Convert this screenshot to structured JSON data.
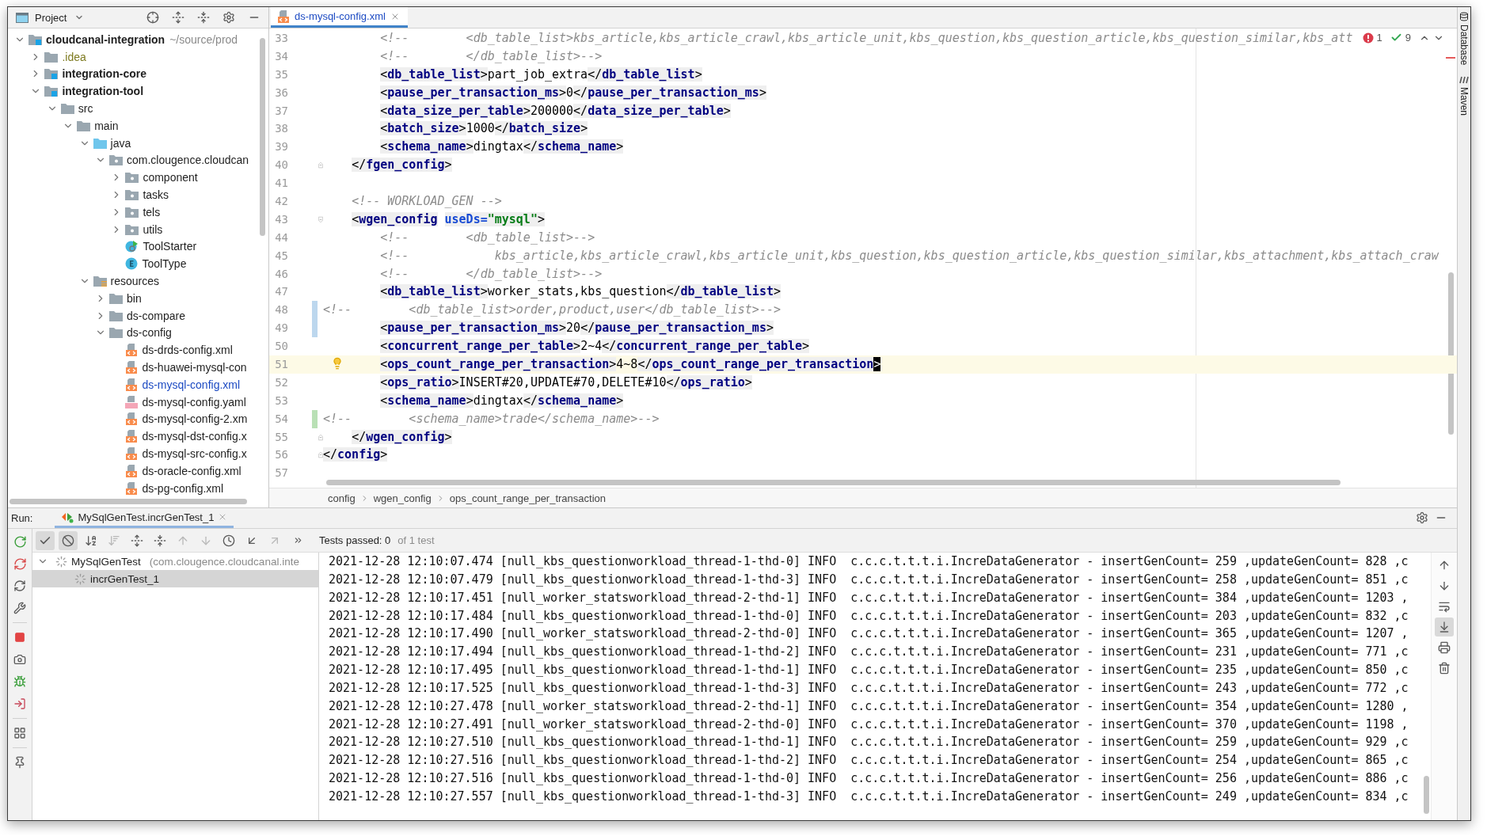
{
  "project": {
    "title": "Project",
    "tree": [
      {
        "label": "cloudcanal-integration",
        "hint": "~/source/prod",
        "kind": "module",
        "expanded": true,
        "children": [
          {
            "label": ".idea",
            "kind": "folder",
            "expanded": false,
            "ignored": true
          },
          {
            "label": "integration-core",
            "kind": "module",
            "expanded": false,
            "ignored": false
          },
          {
            "label": "integration-tool",
            "kind": "module",
            "expanded": true,
            "ignored": false,
            "children": [
              {
                "label": "src",
                "kind": "folder",
                "expanded": true,
                "children": [
                  {
                    "label": "main",
                    "kind": "folder",
                    "expanded": true,
                    "children": [
                      {
                        "label": "java",
                        "kind": "source",
                        "expanded": true,
                        "children": [
                          {
                            "label": "com.clougence.cloudcan",
                            "kind": "package",
                            "expanded": true,
                            "children": [
                              {
                                "label": "component",
                                "kind": "package",
                                "expanded": false
                              },
                              {
                                "label": "tasks",
                                "kind": "package",
                                "expanded": false
                              },
                              {
                                "label": "tels",
                                "kind": "package",
                                "expanded": false
                              },
                              {
                                "label": "utils",
                                "kind": "package",
                                "expanded": false
                              },
                              {
                                "label": "ToolStarter",
                                "kind": "class-main"
                              },
                              {
                                "label": "ToolType",
                                "kind": "enum"
                              }
                            ]
                          }
                        ]
                      },
                      {
                        "label": "resources",
                        "kind": "resources",
                        "expanded": true,
                        "children": [
                          {
                            "label": "bin",
                            "kind": "folder",
                            "expanded": false
                          },
                          {
                            "label": "ds-compare",
                            "kind": "folder",
                            "expanded": false
                          },
                          {
                            "label": "ds-config",
                            "kind": "folder",
                            "expanded": true,
                            "children": [
                              {
                                "label": "ds-drds-config.xml",
                                "kind": "xml",
                                "modified": false
                              },
                              {
                                "label": "ds-huawei-mysql-con",
                                "kind": "xml",
                                "modified": false
                              },
                              {
                                "label": "ds-mysql-config.xml",
                                "kind": "xml",
                                "modified": true
                              },
                              {
                                "label": "ds-mysql-config.yaml",
                                "kind": "yaml",
                                "modified": false
                              },
                              {
                                "label": "ds-mysql-config-2.xm",
                                "kind": "xml",
                                "modified": false
                              },
                              {
                                "label": "ds-mysql-dst-config.x",
                                "kind": "xml",
                                "modified": false
                              },
                              {
                                "label": "ds-mysql-src-config.x",
                                "kind": "xml",
                                "modified": false
                              },
                              {
                                "label": "ds-oracle-config.xml",
                                "kind": "xml",
                                "modified": false
                              },
                              {
                                "label": "ds-pg-config.xml",
                                "kind": "xml",
                                "modified": false
                              }
                            ]
                          }
                        ]
                      }
                    ]
                  }
                ]
              }
            ]
          }
        ]
      }
    ]
  },
  "editor": {
    "tab": {
      "label": "ds-mysql-config.xml",
      "selected": true
    },
    "inspections": {
      "errors": "1",
      "warnings": "9"
    },
    "lines": [
      {
        "number": "33",
        "tokens": [
          {
            "kind": "comment",
            "text": "        <!--        <db_table_list>kbs_article,kbs_article_crawl,kbs_article_unit,kbs_question,kbs_question_article,kbs_question_similar,kbs_att"
          }
        ]
      },
      {
        "number": "34",
        "tokens": [
          {
            "kind": "comment",
            "text": "        <!--        </db_table_list>-->"
          }
        ]
      },
      {
        "number": "35",
        "tokens": [
          {
            "kind": "punct",
            "text": "        <"
          },
          {
            "kind": "tag",
            "text": "db_table_list"
          },
          {
            "kind": "punct",
            "text": ">"
          },
          {
            "kind": "text",
            "text": "part_job_extra"
          },
          {
            "kind": "punct",
            "text": "</"
          },
          {
            "kind": "tag",
            "text": "db_table_list"
          },
          {
            "kind": "punct",
            "text": ">"
          }
        ]
      },
      {
        "number": "36",
        "tokens": [
          {
            "kind": "punct",
            "text": "        <"
          },
          {
            "kind": "tag",
            "text": "pause_per_transaction_ms"
          },
          {
            "kind": "punct",
            "text": ">"
          },
          {
            "kind": "text",
            "text": "0"
          },
          {
            "kind": "punct",
            "text": "</"
          },
          {
            "kind": "tag",
            "text": "pause_per_transaction_ms"
          },
          {
            "kind": "punct",
            "text": ">"
          }
        ]
      },
      {
        "number": "37",
        "tokens": [
          {
            "kind": "punct",
            "text": "        <"
          },
          {
            "kind": "tag",
            "text": "data_size_per_table"
          },
          {
            "kind": "punct",
            "text": ">"
          },
          {
            "kind": "text",
            "text": "200000"
          },
          {
            "kind": "punct",
            "text": "</"
          },
          {
            "kind": "tag",
            "text": "data_size_per_table"
          },
          {
            "kind": "punct",
            "text": ">"
          }
        ]
      },
      {
        "number": "38",
        "tokens": [
          {
            "kind": "punct",
            "text": "        <"
          },
          {
            "kind": "tag",
            "text": "batch_size"
          },
          {
            "kind": "punct",
            "text": ">"
          },
          {
            "kind": "text",
            "text": "1000"
          },
          {
            "kind": "punct",
            "text": "</"
          },
          {
            "kind": "tag",
            "text": "batch_size"
          },
          {
            "kind": "punct",
            "text": ">"
          }
        ]
      },
      {
        "number": "39",
        "tokens": [
          {
            "kind": "punct",
            "text": "        <"
          },
          {
            "kind": "tag",
            "text": "schema_name"
          },
          {
            "kind": "punct",
            "text": ">"
          },
          {
            "kind": "text",
            "text": "dingtax"
          },
          {
            "kind": "punct",
            "text": "</"
          },
          {
            "kind": "tag",
            "text": "schema_name"
          },
          {
            "kind": "punct",
            "text": ">"
          }
        ]
      },
      {
        "number": "40",
        "fold_end": true,
        "tokens": [
          {
            "kind": "punct",
            "text": "    </"
          },
          {
            "kind": "tag",
            "text": "fgen_config"
          },
          {
            "kind": "punct",
            "text": ">"
          }
        ]
      },
      {
        "number": "41"
      },
      {
        "number": "42",
        "tokens": [
          {
            "kind": "comment",
            "text": "    <!-- WORKLOAD_GEN -->"
          }
        ]
      },
      {
        "number": "43",
        "fold_start": true,
        "tokens": [
          {
            "kind": "punct",
            "text": "    <"
          },
          {
            "kind": "tag",
            "text": "wgen_config"
          },
          {
            "kind": "attr",
            "text": " useDs="
          },
          {
            "kind": "value",
            "text": "\"mysql\""
          },
          {
            "kind": "punct",
            "text": ">"
          }
        ]
      },
      {
        "number": "44",
        "tokens": [
          {
            "kind": "comment",
            "text": "        <!--        <db_table_list>-->"
          }
        ]
      },
      {
        "number": "45",
        "tokens": [
          {
            "kind": "comment",
            "text": "        <!--            kbs_article,kbs_article_crawl,kbs_article_unit,kbs_question,kbs_question_article,kbs_question_similar,kbs_attachment,kbs_attach_craw"
          }
        ]
      },
      {
        "number": "46",
        "tokens": [
          {
            "kind": "comment",
            "text": "        <!--        </db_table_list>-->"
          }
        ]
      },
      {
        "number": "47",
        "tokens": [
          {
            "kind": "punct",
            "text": "        <"
          },
          {
            "kind": "tag",
            "text": "db_table_list"
          },
          {
            "kind": "punct",
            "text": ">"
          },
          {
            "kind": "text",
            "text": "worker_stats,kbs_question"
          },
          {
            "kind": "punct",
            "text": "</"
          },
          {
            "kind": "tag",
            "text": "db_table_list"
          },
          {
            "kind": "punct",
            "text": ">"
          }
        ]
      },
      {
        "number": "48",
        "modified": true,
        "tokens": [
          {
            "kind": "comment",
            "text": "<!--        <db_table_list>order,product,user</db_table_list>-->"
          }
        ]
      },
      {
        "number": "49",
        "modified": true,
        "tokens": [
          {
            "kind": "punct",
            "text": "        <"
          },
          {
            "kind": "tag",
            "text": "pause_per_transaction_ms"
          },
          {
            "kind": "punct",
            "text": ">"
          },
          {
            "kind": "text",
            "text": "20"
          },
          {
            "kind": "punct",
            "text": "</"
          },
          {
            "kind": "tag",
            "text": "pause_per_transaction_ms"
          },
          {
            "kind": "punct",
            "text": ">"
          }
        ]
      },
      {
        "number": "50",
        "tokens": [
          {
            "kind": "punct",
            "text": "        <"
          },
          {
            "kind": "tag",
            "text": "concurrent_range_per_table"
          },
          {
            "kind": "punct",
            "text": ">"
          },
          {
            "kind": "text",
            "text": "2~4"
          },
          {
            "kind": "punct",
            "text": "</"
          },
          {
            "kind": "tag",
            "text": "concurrent_range_per_table"
          },
          {
            "kind": "punct",
            "text": ">"
          }
        ]
      },
      {
        "number": "51",
        "current": true,
        "bulb": true,
        "tokens": [
          {
            "kind": "punct",
            "text": "        <"
          },
          {
            "kind": "tag",
            "text": "ops_count_range_per_transaction"
          },
          {
            "kind": "punct",
            "text": ">"
          },
          {
            "kind": "text",
            "text": "4~8"
          },
          {
            "kind": "punct",
            "text": "</"
          },
          {
            "kind": "tag",
            "text": "ops_count_range_per_transaction"
          },
          {
            "kind": "caret",
            "text": ">"
          }
        ]
      },
      {
        "number": "52",
        "tokens": [
          {
            "kind": "punct",
            "text": "        <"
          },
          {
            "kind": "tag",
            "text": "ops_ratio"
          },
          {
            "kind": "punct",
            "text": ">"
          },
          {
            "kind": "text",
            "text": "INSERT#20,UPDATE#70,DELETE#10"
          },
          {
            "kind": "punct",
            "text": "</"
          },
          {
            "kind": "tag",
            "text": "ops_ratio"
          },
          {
            "kind": "punct",
            "text": ">"
          }
        ]
      },
      {
        "number": "53",
        "tokens": [
          {
            "kind": "punct",
            "text": "        <"
          },
          {
            "kind": "tag",
            "text": "schema_name"
          },
          {
            "kind": "punct",
            "text": ">"
          },
          {
            "kind": "text",
            "text": "dingtax"
          },
          {
            "kind": "punct",
            "text": "</"
          },
          {
            "kind": "tag",
            "text": "schema_name"
          },
          {
            "kind": "punct",
            "text": ">"
          }
        ]
      },
      {
        "number": "54",
        "added": true,
        "tokens": [
          {
            "kind": "comment",
            "text": "<!--        <schema_name>trade</schema_name>-->"
          }
        ]
      },
      {
        "number": "55",
        "fold_end": true,
        "tokens": [
          {
            "kind": "punct",
            "text": "    </"
          },
          {
            "kind": "tag",
            "text": "wgen_config"
          },
          {
            "kind": "punct",
            "text": ">"
          }
        ]
      },
      {
        "number": "56",
        "fold_end": true,
        "tokens": [
          {
            "kind": "punct",
            "text": "</"
          },
          {
            "kind": "tag",
            "text": "config"
          },
          {
            "kind": "punct",
            "text": ">"
          }
        ]
      },
      {
        "number": "57"
      }
    ],
    "breadcrumbs": [
      "config",
      "wgen_config",
      "ops_count_range_per_transaction"
    ]
  },
  "side_tools": [
    "Database",
    "Maven"
  ],
  "run": {
    "label": "Run:",
    "tab": {
      "label": "MySqlGenTest.incrGenTest_1",
      "selected": true
    },
    "toolbar": [
      {
        "kind": "show-passed",
        "toggled": true,
        "disabled": false
      },
      {
        "kind": "show-ignored",
        "toggled": true,
        "disabled": false
      },
      {
        "kind": "sort-alpha",
        "toggled": false,
        "disabled": false
      },
      {
        "kind": "sort-duration",
        "toggled": false,
        "disabled": true
      },
      {
        "kind": "expand-all",
        "toggled": false,
        "disabled": false
      },
      {
        "kind": "collapse-all",
        "toggled": false,
        "disabled": false
      },
      {
        "kind": "previous",
        "toggled": false,
        "disabled": true
      },
      {
        "kind": "next",
        "toggled": false,
        "disabled": true
      },
      {
        "kind": "history",
        "toggled": false,
        "disabled": false
      },
      {
        "kind": "import",
        "toggled": false,
        "disabled": false
      },
      {
        "kind": "export",
        "toggled": false,
        "disabled": true
      },
      {
        "kind": "more",
        "toggled": false,
        "disabled": false
      }
    ],
    "status": {
      "passed": "Tests passed: 0",
      "total": "of 1 test"
    },
    "tests": [
      {
        "name": "MySqlGenTest",
        "hint": "(com.clougence.cloudcanal.inte",
        "expanded": true,
        "selected": false,
        "children": [
          {
            "name": "incrGenTest_1",
            "selected": true
          }
        ]
      }
    ],
    "console": [
      "2021-12-28 12:10:07.474 [null_kbs_questionworkload_thread-1-thd-0] INFO  c.c.c.t.t.t.i.IncreDataGenerator - insertGenCount= 259 ,updateGenCount= 828 ,c",
      "2021-12-28 12:10:07.479 [null_kbs_questionworkload_thread-1-thd-3] INFO  c.c.c.t.t.t.i.IncreDataGenerator - insertGenCount= 258 ,updateGenCount= 851 ,c",
      "2021-12-28 12:10:17.451 [null_worker_statsworkload_thread-2-thd-1] INFO  c.c.c.t.t.t.i.IncreDataGenerator - insertGenCount= 384 ,updateGenCount= 1203 ,",
      "2021-12-28 12:10:17.484 [null_kbs_questionworkload_thread-1-thd-0] INFO  c.c.c.t.t.t.i.IncreDataGenerator - insertGenCount= 203 ,updateGenCount= 832 ,c",
      "2021-12-28 12:10:17.490 [null_worker_statsworkload_thread-2-thd-0] INFO  c.c.c.t.t.t.i.IncreDataGenerator - insertGenCount= 365 ,updateGenCount= 1207 ,",
      "2021-12-28 12:10:17.494 [null_kbs_questionworkload_thread-1-thd-2] INFO  c.c.c.t.t.t.i.IncreDataGenerator - insertGenCount= 231 ,updateGenCount= 771 ,c",
      "2021-12-28 12:10:17.495 [null_kbs_questionworkload_thread-1-thd-1] INFO  c.c.c.t.t.t.i.IncreDataGenerator - insertGenCount= 235 ,updateGenCount= 850 ,c",
      "2021-12-28 12:10:17.525 [null_kbs_questionworkload_thread-1-thd-3] INFO  c.c.c.t.t.t.i.IncreDataGenerator - insertGenCount= 243 ,updateGenCount= 772 ,c",
      "2021-12-28 12:10:27.478 [null_worker_statsworkload_thread-2-thd-1] INFO  c.c.c.t.t.t.i.IncreDataGenerator - insertGenCount= 354 ,updateGenCount= 1280 ,",
      "2021-12-28 12:10:27.491 [null_worker_statsworkload_thread-2-thd-0] INFO  c.c.c.t.t.t.i.IncreDataGenerator - insertGenCount= 370 ,updateGenCount= 1198 ,",
      "2021-12-28 12:10:27.510 [null_kbs_questionworkload_thread-1-thd-1] INFO  c.c.c.t.t.t.i.IncreDataGenerator - insertGenCount= 259 ,updateGenCount= 929 ,c",
      "2021-12-28 12:10:27.516 [null_kbs_questionworkload_thread-1-thd-2] INFO  c.c.c.t.t.t.i.IncreDataGenerator - insertGenCount= 254 ,updateGenCount= 865 ,c",
      "2021-12-28 12:10:27.516 [null_kbs_questionworkload_thread-1-thd-0] INFO  c.c.c.t.t.t.i.IncreDataGenerator - insertGenCount= 256 ,updateGenCount= 886 ,c",
      "2021-12-28 12:10:27.557 [null_kbs_questionworkload_thread-1-thd-3] INFO  c.c.c.t.t.t.i.IncreDataGenerator - insertGenCount= 249 ,updateGenCount= 834 ,c"
    ],
    "console_tools": [
      {
        "kind": "up",
        "toggled": false
      },
      {
        "kind": "down",
        "toggled": false
      },
      {
        "kind": "wrap",
        "toggled": false
      },
      {
        "kind": "scroll-end",
        "toggled": true
      },
      {
        "kind": "print",
        "toggled": false
      },
      {
        "kind": "clear",
        "toggled": false
      }
    ]
  }
}
